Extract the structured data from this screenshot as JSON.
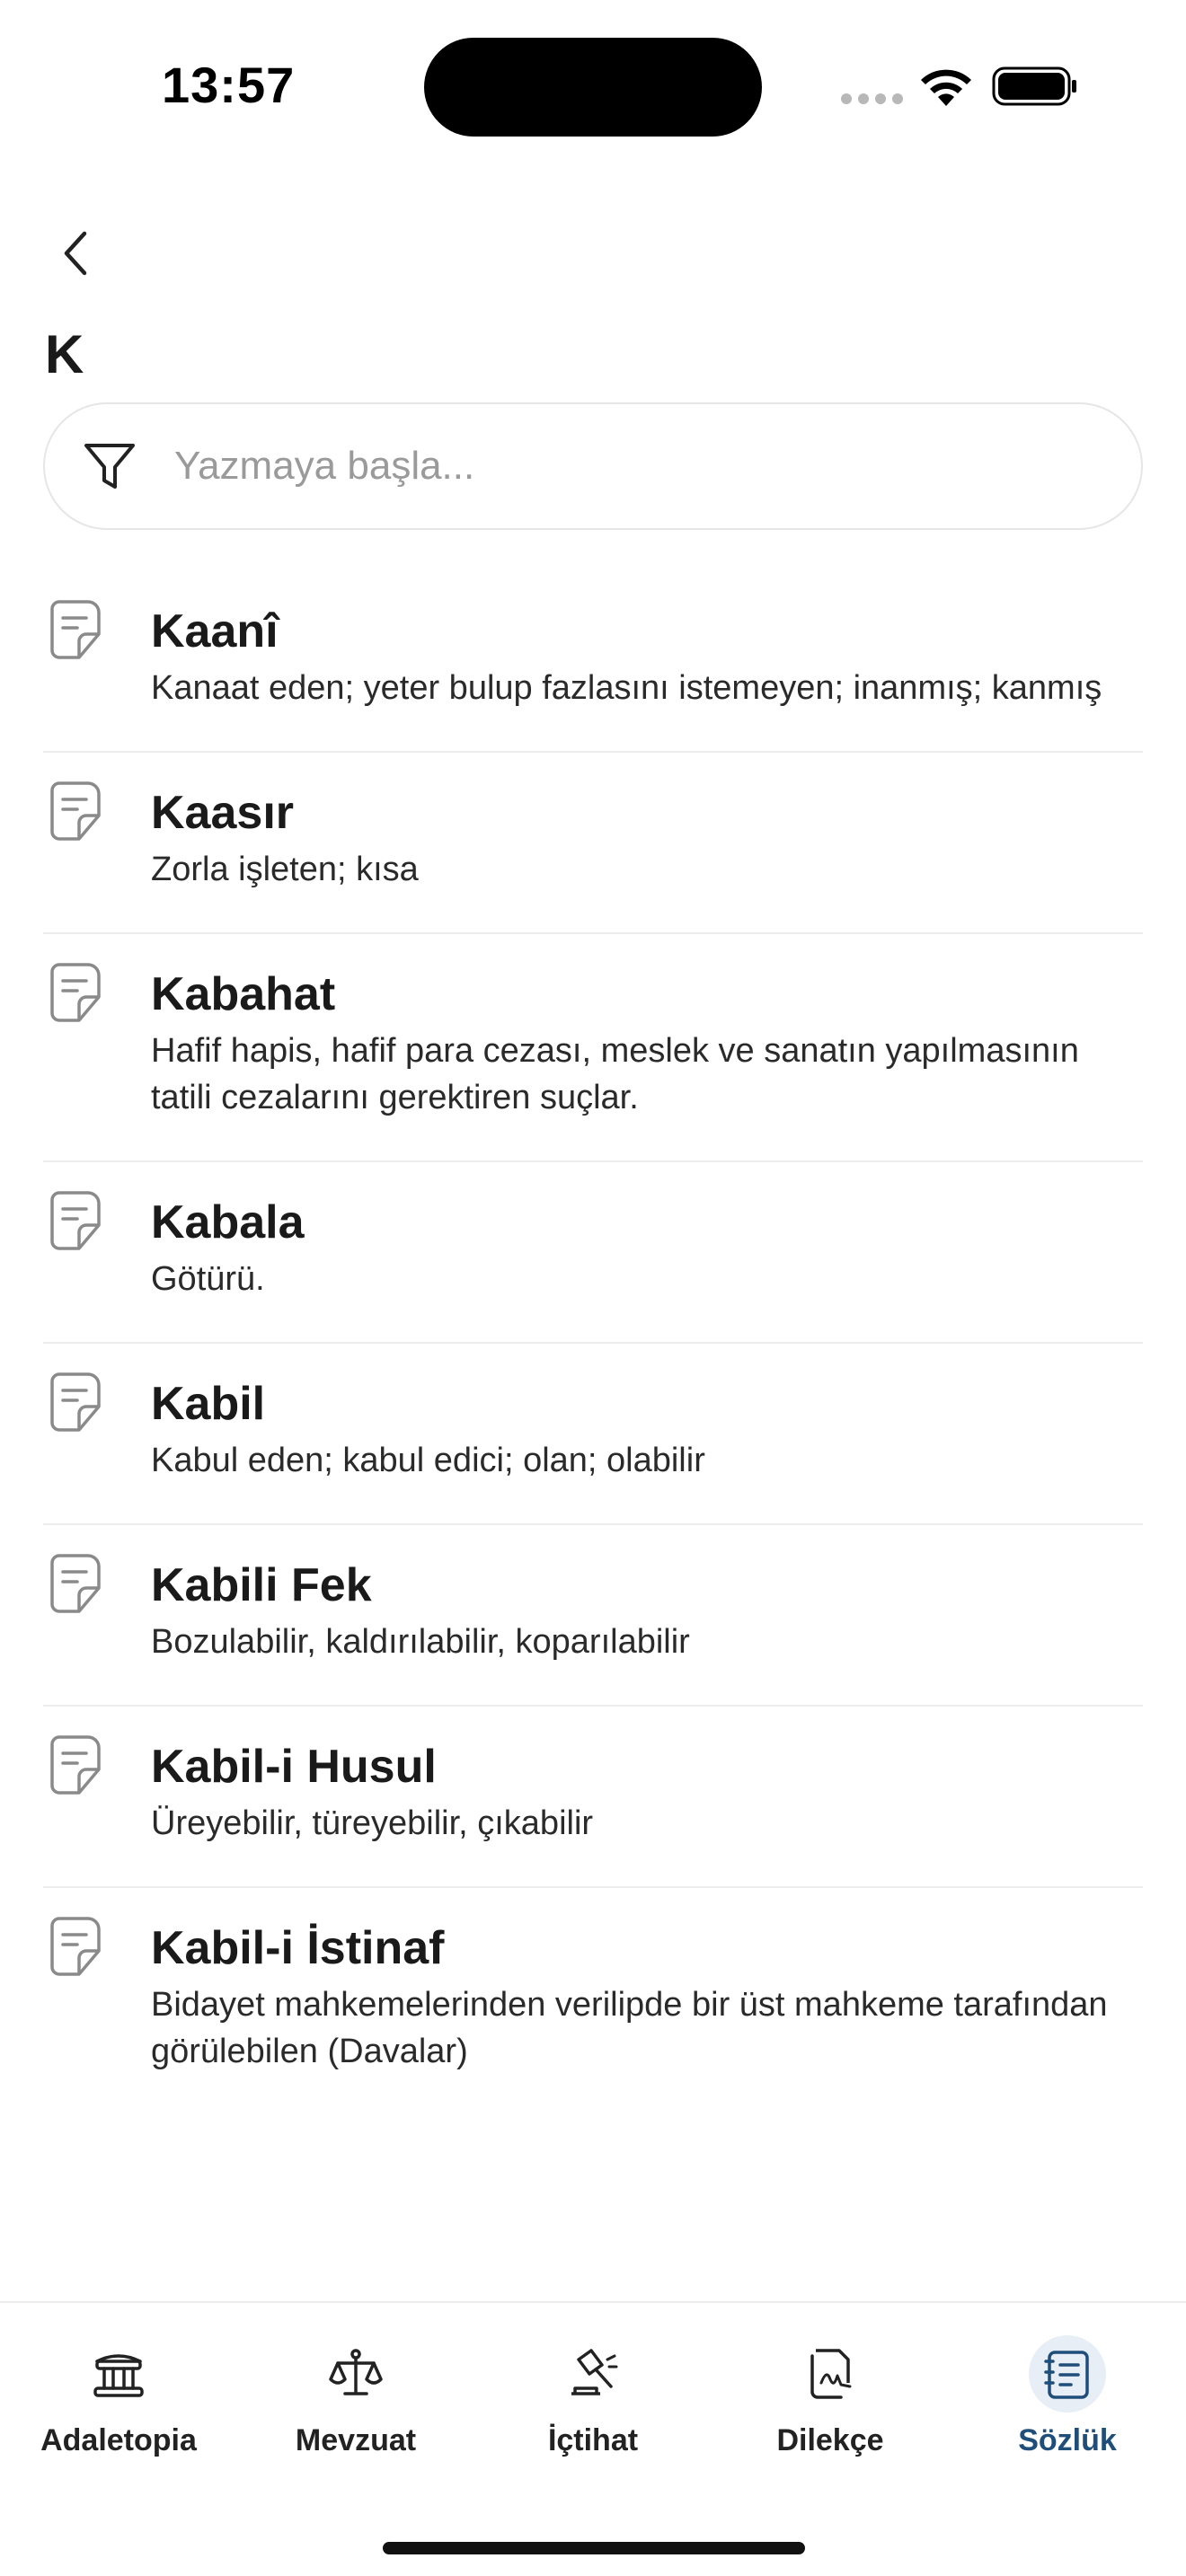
{
  "status_bar": {
    "time": "13:57"
  },
  "header": {
    "title": "K"
  },
  "search": {
    "placeholder": "Yazmaya başla..."
  },
  "entries": [
    {
      "term": "Kaanî",
      "definition": "Kanaat eden; yeter bulup fazlasını istemeyen; inanmış; kanmış"
    },
    {
      "term": "Kaasır",
      "definition": "Zorla işleten; kısa"
    },
    {
      "term": "Kabahat",
      "definition": "Hafif hapis, hafif para cezası, meslek ve sanatın yapılmasının tatili cezalarını gerektiren suçlar."
    },
    {
      "term": "Kabala",
      "definition": "Götürü."
    },
    {
      "term": "Kabil",
      "definition": "Kabul eden; kabul edici; olan; olabilir"
    },
    {
      "term": "Kabili Fek",
      "definition": "Bozulabilir, kaldırılabilir, koparılabilir"
    },
    {
      "term": "Kabil-i Husul",
      "definition": "Üreyebilir, türeyebilir, çıkabilir"
    },
    {
      "term": "Kabil-i İstinaf",
      "definition": "Bidayet mahkemelerinden verilipde bir üst mahkeme tarafından görülebilen (Davalar)"
    }
  ],
  "bottom_nav": {
    "items": [
      {
        "label": "Adaletopia",
        "icon": "courthouse-icon"
      },
      {
        "label": "Mevzuat",
        "icon": "scales-icon"
      },
      {
        "label": "İçtihat",
        "icon": "gavel-icon"
      },
      {
        "label": "Dilekçe",
        "icon": "signed-document-icon"
      },
      {
        "label": "Sözlük",
        "icon": "dictionary-icon"
      }
    ],
    "active_index": 4,
    "active_color": "#1f4e7a"
  }
}
